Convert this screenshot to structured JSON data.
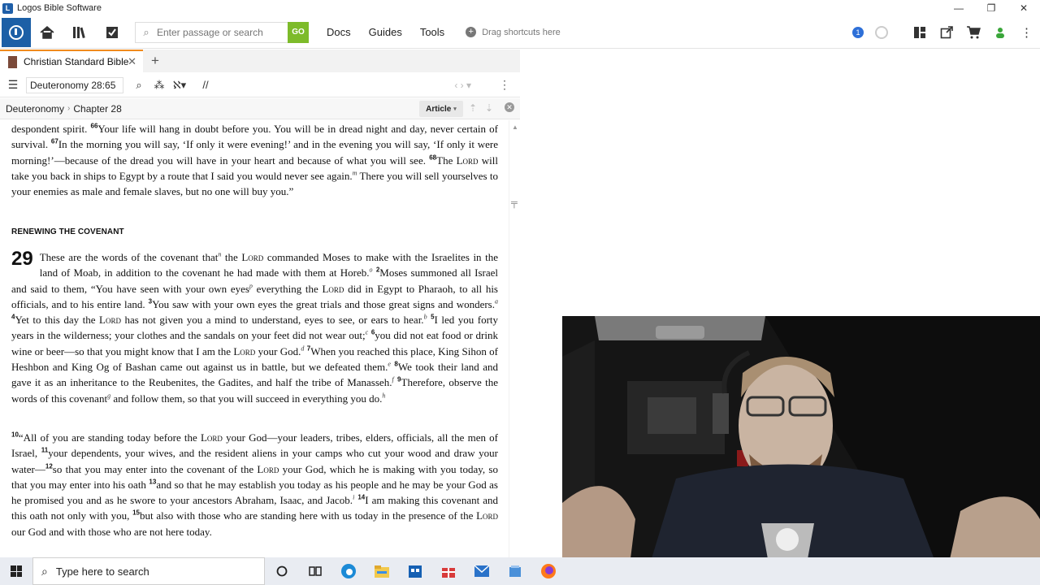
{
  "window": {
    "title": "Logos Bible Software",
    "controls": [
      "—",
      "❐",
      "✕"
    ]
  },
  "toolbar": {
    "search_placeholder": "Enter passage or search",
    "go_label": "GO",
    "menus": [
      "Docs",
      "Guides",
      "Tools"
    ],
    "shortcut_hint": "Drag shortcuts here",
    "notification_count": "1"
  },
  "tabs": [
    {
      "label": "Christian Standard Bible",
      "close": "✕"
    }
  ],
  "tab_add": "+",
  "panel": {
    "reference": "Deuteronomy 28:65",
    "breadcrumb": [
      "Deuteronomy",
      "Chapter 28"
    ],
    "view_mode": "Article"
  },
  "text": {
    "p1": {
      "a": "despondent spirit. ",
      "v66": "66",
      "b": "Your life will hang in doubt before you. You will be in dread night and day, never certain of survival. ",
      "v67": "67",
      "c": "In the morning you will say, ‘If only it were evening!’ and in the evening you will say, ‘If only it were morning!’—because of the dread you will have in your heart and because of what you will see. ",
      "v68": "68",
      "d": "The ",
      "lord": "Lord",
      "e": " will take you back in ships to Egypt by a route that I said you would never see again.",
      "fn_m": "m",
      "f": " There you will sell yourselves to your enemies as male and female slaves, but no one will buy you.”"
    },
    "heading": "RENEWING THE COVENANT",
    "chapter": "29",
    "p2": [
      {
        "t": "These are the words of the covenant that"
      },
      {
        "fn": "n"
      },
      {
        "t": " the "
      },
      {
        "sc": "Lord"
      },
      {
        "t": " commanded Moses to make with the Israelites in the land of Moab, in addition to the covenant he had made with them at Horeb."
      },
      {
        "fn": "o"
      },
      {
        "t": " "
      },
      {
        "v": "2"
      },
      {
        "t": "Moses summoned all Israel and said to them, “You have seen with your own eyes"
      },
      {
        "fn": "p"
      },
      {
        "t": " everything the "
      },
      {
        "sc": "Lord"
      },
      {
        "t": " did in Egypt to Pharaoh, to all his officials, and to his entire land. "
      },
      {
        "v": "3"
      },
      {
        "t": "You saw with your own eyes the great trials and those great signs and wonders."
      },
      {
        "fn": "a"
      },
      {
        "t": " "
      },
      {
        "v": "4"
      },
      {
        "t": "Yet to this day the "
      },
      {
        "sc": "Lord"
      },
      {
        "t": " has not given you a mind to understand, eyes to see, or ears to hear."
      },
      {
        "fn": "b"
      },
      {
        "t": " "
      },
      {
        "v": "5"
      },
      {
        "t": "I led you forty years in the wilderness; your clothes and the sandals on your feet did not wear out;"
      },
      {
        "fn": "c"
      },
      {
        "t": " "
      },
      {
        "v": "6"
      },
      {
        "t": "you did not eat food or drink wine or beer—so that you might know that I am the "
      },
      {
        "sc": "Lord"
      },
      {
        "t": " your God."
      },
      {
        "fn": "d"
      },
      {
        "t": " "
      },
      {
        "v": "7"
      },
      {
        "t": "When you reached this place, King Sihon of Heshbon and King Og of Bashan came out against us in battle, but we defeated them."
      },
      {
        "fn": "e"
      },
      {
        "t": " "
      },
      {
        "v": "8"
      },
      {
        "t": "We took their land and gave it as an inheritance to the Reubenites, the Gadites, and half the tribe of Manasseh."
      },
      {
        "fn": "f"
      },
      {
        "t": " "
      },
      {
        "v": "9"
      },
      {
        "t": "Therefore, observe the words of this covenant"
      },
      {
        "fn": "g"
      },
      {
        "t": " and follow them, so that you will succeed in everything you do."
      },
      {
        "fn": "h"
      }
    ],
    "p3": [
      {
        "v": "10"
      },
      {
        "t": "“All of you are standing today before the "
      },
      {
        "sc": "Lord"
      },
      {
        "t": " your God—your leaders, tribes, elders, officials, all the men of Israel, "
      },
      {
        "v": "11"
      },
      {
        "t": "your dependents, your wives, and the resident aliens in your camps who cut your wood and draw your water—"
      },
      {
        "v": "12"
      },
      {
        "t": "so that you may enter into the covenant of the "
      },
      {
        "sc": "Lord"
      },
      {
        "t": " your God, which he is making with you today, so that you may enter into his oath "
      },
      {
        "v": "13"
      },
      {
        "t": "and so that he may establish you today as his people and he may be your God as he promised you and as he swore to your ancestors Abraham, Isaac, and Jacob."
      },
      {
        "fn": "i"
      },
      {
        "t": " "
      },
      {
        "v": "14"
      },
      {
        "t": "I am making this covenant and this oath not only with you, "
      },
      {
        "v": "15"
      },
      {
        "t": "but also with those who are standing here with us today in the presence of the "
      },
      {
        "sc": "Lord"
      },
      {
        "t": " our God and with those who are not here today."
      }
    ]
  },
  "taskbar": {
    "search_placeholder": "Type here to search"
  },
  "icons": {
    "home": "home-icon",
    "library": "library-icon",
    "tasks": "tasks-icon",
    "search": "search-icon",
    "layouts": "layouts-icon",
    "cart": "cart-icon"
  },
  "colors": {
    "brand": "#1c5fa6",
    "go": "#7dbb2a",
    "tab_accent": "#f08a1c"
  }
}
